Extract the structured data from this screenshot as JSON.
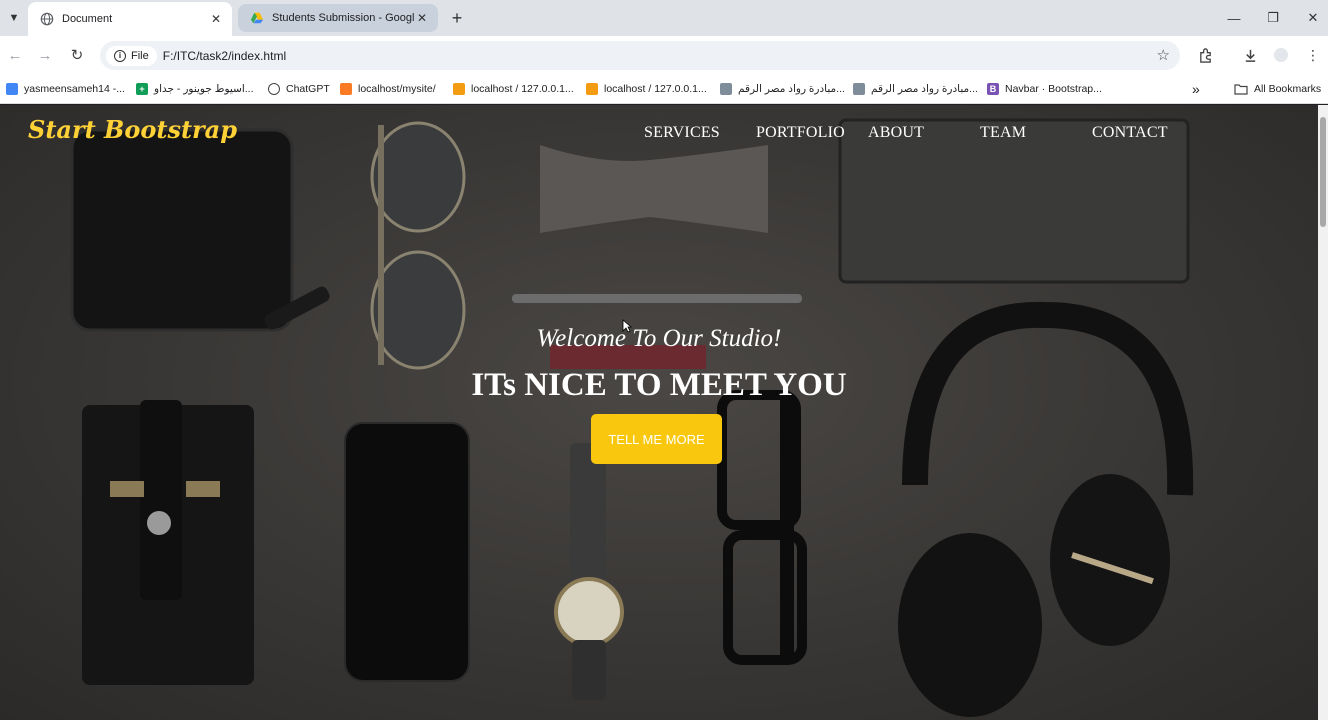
{
  "browser": {
    "tabs": [
      {
        "title": "Document",
        "active": true
      },
      {
        "title": "Students Submission - Google",
        "active": false
      }
    ],
    "address": {
      "chip": "File",
      "url": "F:/ITC/task2/index.html"
    },
    "bookmarks": [
      {
        "label": "yasmeensameh14 -...",
        "icon": "google-sheets-icon"
      },
      {
        "label": "اسيوط جوينور - جداو...",
        "icon": "sheets-plus-icon"
      },
      {
        "label": "ChatGPT",
        "icon": "chatgpt-icon"
      },
      {
        "label": "localhost/mysite/",
        "icon": "xampp-icon"
      },
      {
        "label": "localhost / 127.0.0.1...",
        "icon": "phpmyadmin-icon"
      },
      {
        "label": "localhost / 127.0.0.1...",
        "icon": "phpmyadmin-icon"
      },
      {
        "label": "مبادرة رواد مصر الرقم...",
        "icon": "initiative-icon"
      },
      {
        "label": "مبادرة رواد مصر الرقم...",
        "icon": "initiative-icon"
      },
      {
        "label": "Navbar · Bootstrap...",
        "icon": "bootstrap-icon"
      }
    ],
    "all_bookmarks": "All Bookmarks"
  },
  "site": {
    "brand": "Start Bootstrap",
    "nav": [
      "SERVICES",
      "PORTFOLIO",
      "ABOUT",
      "TEAM",
      "CONTACT"
    ],
    "welcome": "Welcome To Our Studio!",
    "headline": "ITs NICE TO MEET YOU",
    "cta": "TELL ME MORE"
  },
  "colors": {
    "brand": "#fed136",
    "cta": "#f9c80e",
    "text": "#ffffff"
  }
}
